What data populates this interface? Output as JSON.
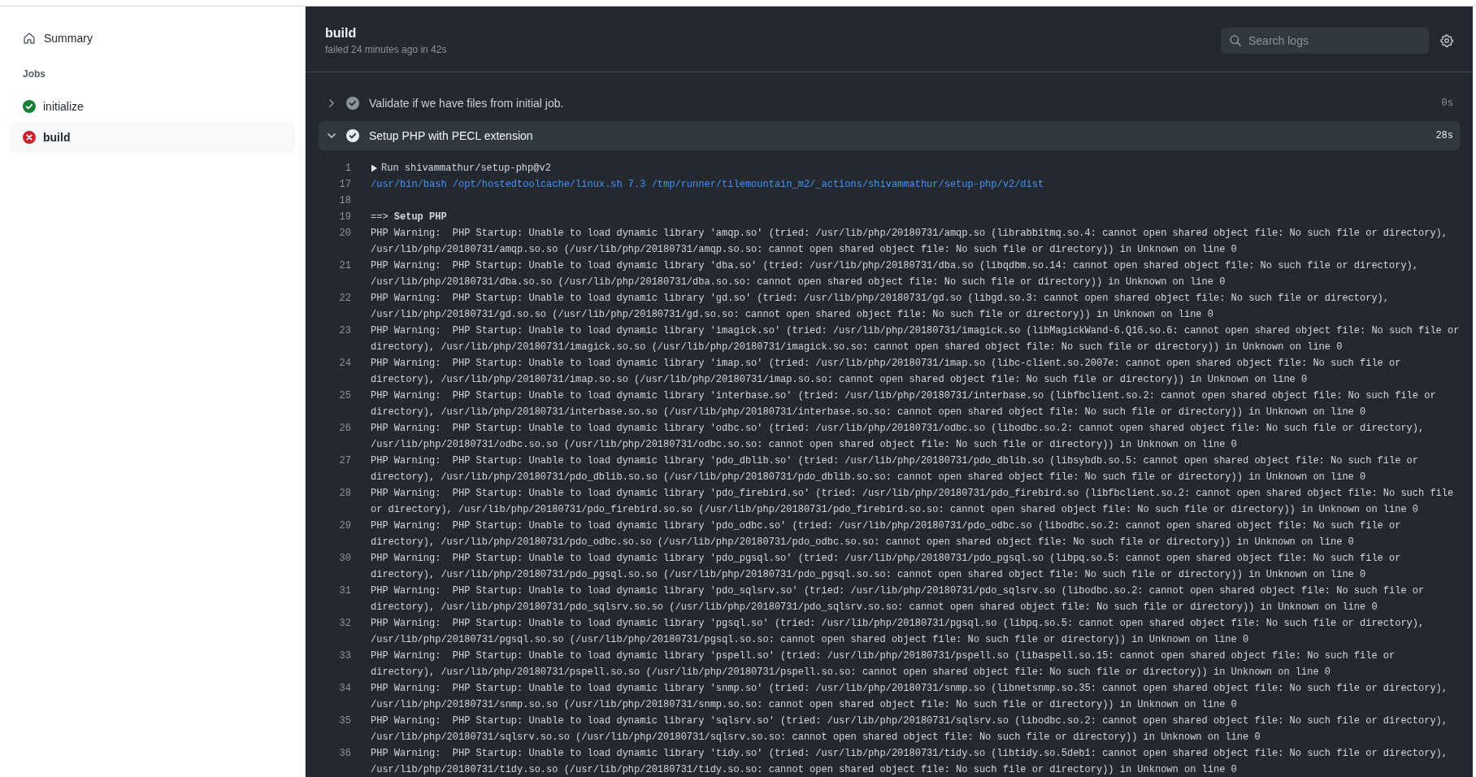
{
  "sidebar": {
    "summary": {
      "label": "Summary"
    },
    "jobs_heading": "Jobs",
    "jobs": [
      {
        "name": "initialize",
        "failed": false,
        "selected": false
      },
      {
        "name": "build",
        "failed": true,
        "selected": true
      }
    ]
  },
  "header": {
    "title": "build",
    "subtitle": "failed 24 minutes ago in 42s",
    "search": {
      "placeholder": "Search logs"
    }
  },
  "steps": [
    {
      "name": "Validate if we have files from initial job.",
      "expanded": false,
      "duration": "0s"
    },
    {
      "name": "Setup PHP with PECL extension",
      "expanded": true,
      "duration": "28s"
    }
  ],
  "log_lines": [
    {
      "number": "1",
      "kind": "group",
      "expanded": false,
      "text": "Run shivammathur/setup-php@v2"
    },
    {
      "number": "17",
      "kind": "command",
      "text": "/usr/bin/bash /opt/hostedtoolcache/linux.sh 7.3 /tmp/runner/tilemountain_m2/_actions/shivammathur/setup-php/v2/dist"
    },
    {
      "number": "18",
      "kind": "plain"
    },
    {
      "number": "19",
      "kind": "plain",
      "text": "==> **Setup PHP**"
    },
    {
      "number": "20",
      "kind": "plain",
      "text": "PHP Warning:  PHP Startup: Unable to load dynamic library 'amqp.so' (tried: /usr/lib/php/20180731/amqp.so (librabbitmq.so.4: cannot open shared object file: No such file or directory), /usr/lib/php/20180731/amqp.so.so (/usr/lib/php/20180731/amqp.so.so: cannot open shared object file: No such file or directory)) in Unknown on line 0"
    },
    {
      "number": "21",
      "kind": "plain",
      "text": "PHP Warning:  PHP Startup: Unable to load dynamic library 'dba.so' (tried: /usr/lib/php/20180731/dba.so (libqdbm.so.14: cannot open shared object file: No such file or directory), /usr/lib/php/20180731/dba.so.so (/usr/lib/php/20180731/dba.so.so: cannot open shared object file: No such file or directory)) in Unknown on line 0"
    },
    {
      "number": "22",
      "kind": "plain",
      "text": "PHP Warning:  PHP Startup: Unable to load dynamic library 'gd.so' (tried: /usr/lib/php/20180731/gd.so (libgd.so.3: cannot open shared object file: No such file or directory), /usr/lib/php/20180731/gd.so.so (/usr/lib/php/20180731/gd.so.so: cannot open shared object file: No such file or directory)) in Unknown on line 0"
    },
    {
      "number": "23",
      "kind": "plain",
      "text": "PHP Warning:  PHP Startup: Unable to load dynamic library 'imagick.so' (tried: /usr/lib/php/20180731/imagick.so (libMagickWand-6.Q16.so.6: cannot open shared object file: No such file or directory), /usr/lib/php/20180731/imagick.so.so (/usr/lib/php/20180731/imagick.so.so: cannot open shared object file: No such file or directory)) in Unknown on line 0"
    },
    {
      "number": "24",
      "kind": "plain",
      "text": "PHP Warning:  PHP Startup: Unable to load dynamic library 'imap.so' (tried: /usr/lib/php/20180731/imap.so (libc-client.so.2007e: cannot open shared object file: No such file or directory), /usr/lib/php/20180731/imap.so.so (/usr/lib/php/20180731/imap.so.so: cannot open shared object file: No such file or directory)) in Unknown on line 0"
    },
    {
      "number": "25",
      "kind": "plain",
      "text": "PHP Warning:  PHP Startup: Unable to load dynamic library 'interbase.so' (tried: /usr/lib/php/20180731/interbase.so (libfbclient.so.2: cannot open shared object file: No such file or directory), /usr/lib/php/20180731/interbase.so.so (/usr/lib/php/20180731/interbase.so.so: cannot open shared object file: No such file or directory)) in Unknown on line 0"
    },
    {
      "number": "26",
      "kind": "plain",
      "text": "PHP Warning:  PHP Startup: Unable to load dynamic library 'odbc.so' (tried: /usr/lib/php/20180731/odbc.so (libodbc.so.2: cannot open shared object file: No such file or directory), /usr/lib/php/20180731/odbc.so.so (/usr/lib/php/20180731/odbc.so.so: cannot open shared object file: No such file or directory)) in Unknown on line 0"
    },
    {
      "number": "27",
      "kind": "plain",
      "text": "PHP Warning:  PHP Startup: Unable to load dynamic library 'pdo_dblib.so' (tried: /usr/lib/php/20180731/pdo_dblib.so (libsybdb.so.5: cannot open shared object file: No such file or directory), /usr/lib/php/20180731/pdo_dblib.so.so (/usr/lib/php/20180731/pdo_dblib.so.so: cannot open shared object file: No such file or directory)) in Unknown on line 0"
    },
    {
      "number": "28",
      "kind": "plain",
      "text": "PHP Warning:  PHP Startup: Unable to load dynamic library 'pdo_firebird.so' (tried: /usr/lib/php/20180731/pdo_firebird.so (libfbclient.so.2: cannot open shared object file: No such file or directory), /usr/lib/php/20180731/pdo_firebird.so.so (/usr/lib/php/20180731/pdo_firebird.so.so: cannot open shared object file: No such file or directory)) in Unknown on line 0"
    },
    {
      "number": "29",
      "kind": "plain",
      "text": "PHP Warning:  PHP Startup: Unable to load dynamic library 'pdo_odbc.so' (tried: /usr/lib/php/20180731/pdo_odbc.so (libodbc.so.2: cannot open shared object file: No such file or directory), /usr/lib/php/20180731/pdo_odbc.so.so (/usr/lib/php/20180731/pdo_odbc.so.so: cannot open shared object file: No such file or directory)) in Unknown on line 0"
    },
    {
      "number": "30",
      "kind": "plain",
      "text": "PHP Warning:  PHP Startup: Unable to load dynamic library 'pdo_pgsql.so' (tried: /usr/lib/php/20180731/pdo_pgsql.so (libpq.so.5: cannot open shared object file: No such file or directory), /usr/lib/php/20180731/pdo_pgsql.so.so (/usr/lib/php/20180731/pdo_pgsql.so.so: cannot open shared object file: No such file or directory)) in Unknown on line 0"
    },
    {
      "number": "31",
      "kind": "plain",
      "text": "PHP Warning:  PHP Startup: Unable to load dynamic library 'pdo_sqlsrv.so' (tried: /usr/lib/php/20180731/pdo_sqlsrv.so (libodbc.so.2: cannot open shared object file: No such file or directory), /usr/lib/php/20180731/pdo_sqlsrv.so.so (/usr/lib/php/20180731/pdo_sqlsrv.so.so: cannot open shared object file: No such file or directory)) in Unknown on line 0"
    },
    {
      "number": "32",
      "kind": "plain",
      "text": "PHP Warning:  PHP Startup: Unable to load dynamic library 'pgsql.so' (tried: /usr/lib/php/20180731/pgsql.so (libpq.so.5: cannot open shared object file: No such file or directory), /usr/lib/php/20180731/pgsql.so.so (/usr/lib/php/20180731/pgsql.so.so: cannot open shared object file: No such file or directory)) in Unknown on line 0"
    },
    {
      "number": "33",
      "kind": "plain",
      "text": "PHP Warning:  PHP Startup: Unable to load dynamic library 'pspell.so' (tried: /usr/lib/php/20180731/pspell.so (libaspell.so.15: cannot open shared object file: No such file or directory), /usr/lib/php/20180731/pspell.so.so (/usr/lib/php/20180731/pspell.so.so: cannot open shared object file: No such file or directory)) in Unknown on line 0"
    },
    {
      "number": "34",
      "kind": "plain",
      "text": "PHP Warning:  PHP Startup: Unable to load dynamic library 'snmp.so' (tried: /usr/lib/php/20180731/snmp.so (libnetsnmp.so.35: cannot open shared object file: No such file or directory), /usr/lib/php/20180731/snmp.so.so (/usr/lib/php/20180731/snmp.so.so: cannot open shared object file: No such file or directory)) in Unknown on line 0"
    },
    {
      "number": "35",
      "kind": "plain",
      "text": "PHP Warning:  PHP Startup: Unable to load dynamic library 'sqlsrv.so' (tried: /usr/lib/php/20180731/sqlsrv.so (libodbc.so.2: cannot open shared object file: No such file or directory), /usr/lib/php/20180731/sqlsrv.so.so (/usr/lib/php/20180731/sqlsrv.so.so: cannot open shared object file: No such file or directory)) in Unknown on line 0"
    },
    {
      "number": "36",
      "kind": "plain",
      "text": "PHP Warning:  PHP Startup: Unable to load dynamic library 'tidy.so' (tried: /usr/lib/php/20180731/tidy.so (libtidy.so.5deb1: cannot open shared object file: No such file or directory), /usr/lib/php/20180731/tidy.so.so (/usr/lib/php/20180731/tidy.so.so: cannot open shared object file: No such file or directory)) in Unknown on line 0"
    }
  ]
}
